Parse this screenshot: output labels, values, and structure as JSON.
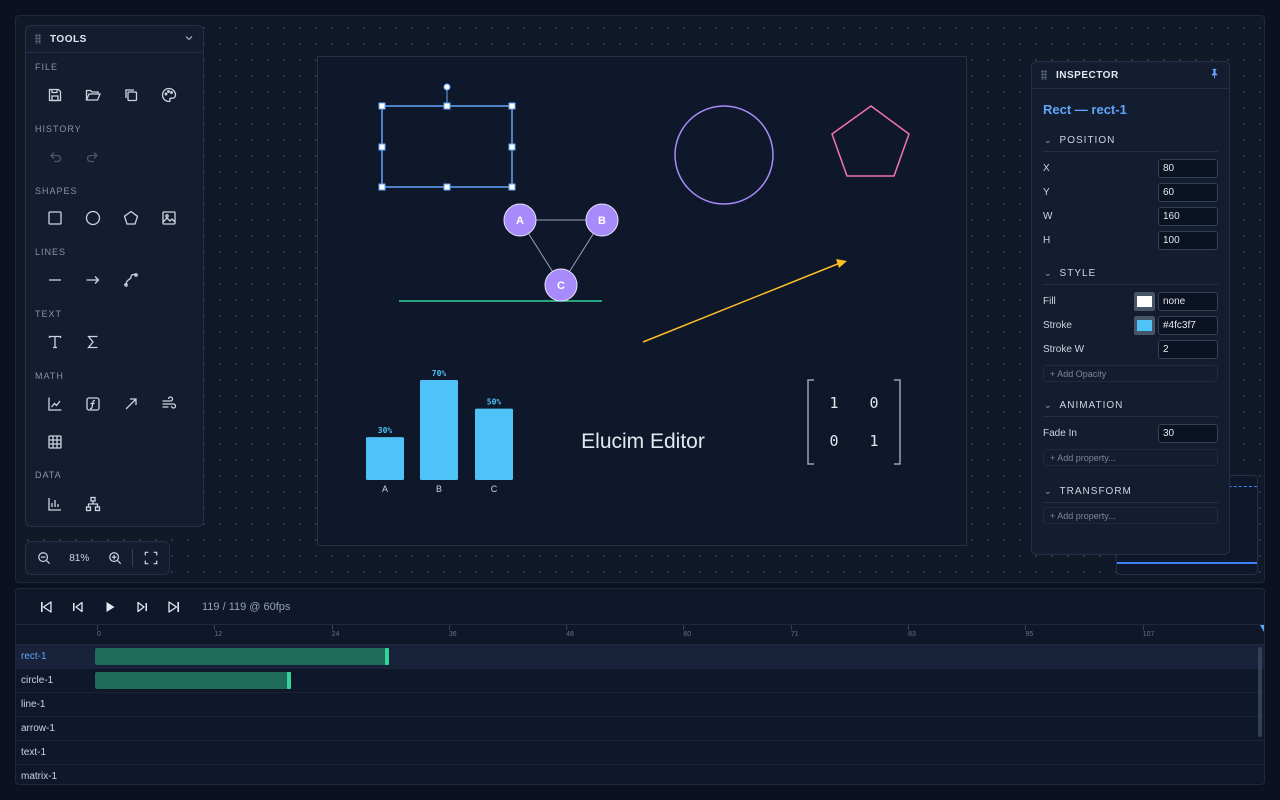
{
  "tools": {
    "title": "TOOLS",
    "sections": {
      "file": "FILE",
      "history": "HISTORY",
      "shapes": "SHAPES",
      "lines": "LINES",
      "text": "TEXT",
      "math": "MATH",
      "data": "DATA"
    },
    "icons": {
      "file": [
        "save-icon",
        "folder-open-icon",
        "copy-icon",
        "palette-icon"
      ],
      "history": [
        "undo-icon",
        "redo-icon"
      ],
      "shapes": [
        "rectangle-icon",
        "circle-icon",
        "pentagon-icon",
        "image-icon"
      ],
      "lines": [
        "line-icon",
        "arrow-icon",
        "curve-icon"
      ],
      "text": [
        "text-icon",
        "sigma-icon"
      ],
      "math": [
        "axes-icon",
        "function-icon",
        "vector-icon",
        "vector-field-icon",
        "table-grid-icon"
      ],
      "data": [
        "bar-chart-icon",
        "tree-icon"
      ]
    }
  },
  "zoom": {
    "value": "81%"
  },
  "canvas": {
    "graph_nodes": [
      "A",
      "B",
      "C"
    ],
    "text_label": "Elucim Editor",
    "matrix": [
      [
        "1",
        "0"
      ],
      [
        "0",
        "1"
      ]
    ],
    "colors": {
      "selection": "#60a5fa",
      "circle": "#a78bfa",
      "pentagon": "#f472b6",
      "arrow": "#fbbf24",
      "line": "#34d399",
      "node": "#a78bfa",
      "bar": "#4fc3f7"
    }
  },
  "chart_data": {
    "type": "bar",
    "categories": [
      "A",
      "B",
      "C"
    ],
    "values": [
      30,
      70,
      50
    ],
    "value_labels": [
      "30%",
      "70%",
      "50%"
    ],
    "title": "",
    "xlabel": "",
    "ylabel": "",
    "ylim": [
      0,
      70
    ],
    "grid": false
  },
  "inspector": {
    "title": "INSPECTOR",
    "object_title": "Rect — rect-1",
    "sections": {
      "position": "POSITION",
      "style": "STYLE",
      "animation": "ANIMATION",
      "transform": "TRANSFORM"
    },
    "position": {
      "x_label": "X",
      "x": "80",
      "y_label": "Y",
      "y": "60",
      "w_label": "W",
      "w": "160",
      "h_label": "H",
      "h": "100"
    },
    "style": {
      "fill_label": "Fill",
      "fill": "none",
      "fill_color": "#ffffff",
      "stroke_label": "Stroke",
      "stroke": "#4fc3f7",
      "stroke_color": "#4fc3f7",
      "stroke_w_label": "Stroke W",
      "stroke_w": "2",
      "add_opacity": "+ Add Opacity"
    },
    "animation": {
      "fade_in_label": "Fade In",
      "fade_in": "30",
      "add_property": "+ Add property..."
    },
    "transform": {
      "add_property": "+ Add property..."
    }
  },
  "timeline": {
    "frame_readout": "119 / 119 @ 60fps",
    "ticks": [
      "0",
      "12",
      "24",
      "36",
      "48",
      "60",
      "71",
      "83",
      "95",
      "107"
    ],
    "total_frames": 119,
    "tracks": [
      {
        "name": "rect-1",
        "start": 0,
        "end": 30,
        "selected": true
      },
      {
        "name": "circle-1",
        "start": 0,
        "end": 20,
        "selected": false
      },
      {
        "name": "line-1"
      },
      {
        "name": "arrow-1"
      },
      {
        "name": "text-1"
      },
      {
        "name": "matrix-1"
      }
    ]
  }
}
